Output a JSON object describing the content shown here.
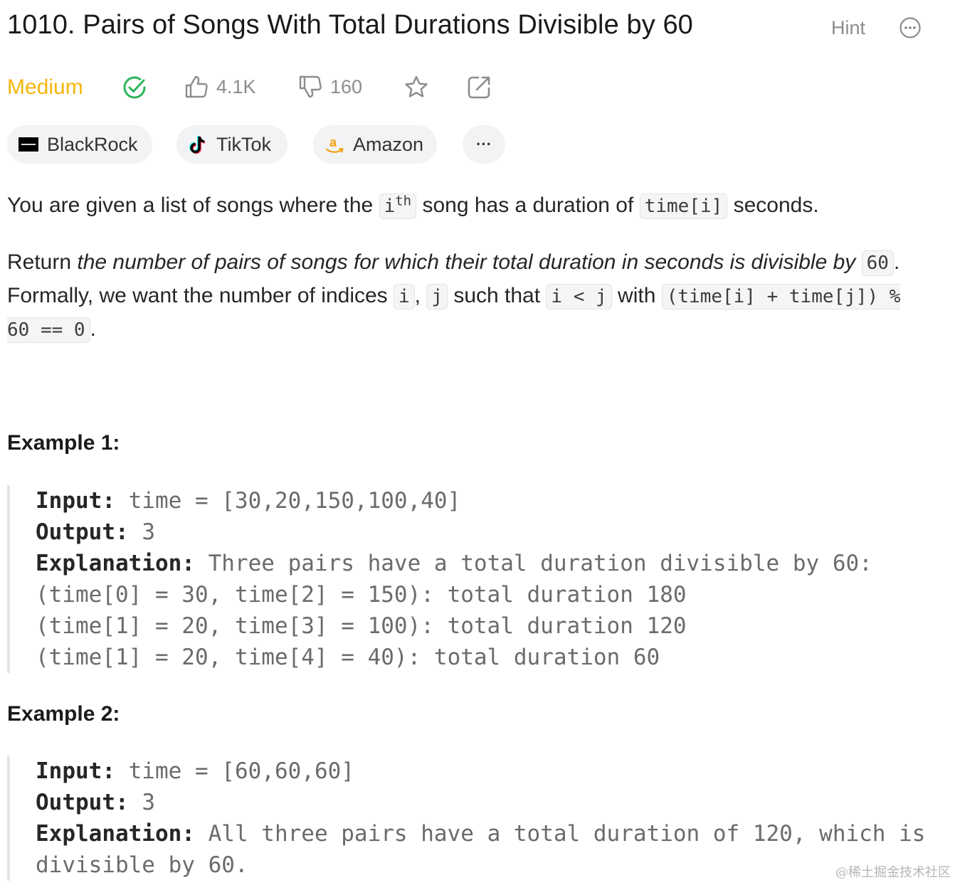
{
  "problem": {
    "title": "1010. Pairs of Songs With Total Durations Divisible by 60",
    "hint_label": "Hint",
    "difficulty": "Medium",
    "likes": "4.1K",
    "dislikes": "160"
  },
  "companies": [
    {
      "name": "BlackRock",
      "logo": "blackrock-logo"
    },
    {
      "name": "TikTok",
      "logo": "tiktok-logo"
    },
    {
      "name": "Amazon",
      "logo": "amazon-logo"
    }
  ],
  "more_label": "···",
  "description": {
    "p1_a": "You are given a list of songs where the ",
    "p1_code1": "i",
    "p1_sup": "th",
    "p1_b": " song has a duration of ",
    "p1_code2": "time[i]",
    "p1_c": " seconds.",
    "p2_a": "Return ",
    "p2_em": "the number of pairs of songs for which their total duration in seconds is divisible by",
    "p2_code1": "60",
    "p2_b": ". Formally, we want the number of indices ",
    "p2_code2": "i",
    "p2_c": ", ",
    "p2_code3": "j",
    "p2_d": " such that ",
    "p2_code4": "i < j",
    "p2_e": " with ",
    "p2_code5": "(time[i] + time[j]) % 60 == 0",
    "p2_f": "."
  },
  "examples": [
    {
      "heading": "Example 1:",
      "input_label": "Input:",
      "input": " time = [30,20,150,100,40]",
      "output_label": "Output:",
      "output": " 3",
      "explanation_label": "Explanation:",
      "explanation": " Three pairs have a total duration divisible by 60:",
      "extra": [
        "(time[0] = 30, time[2] = 150): total duration 180",
        "(time[1] = 20, time[3] = 100): total duration 120",
        "(time[1] = 20, time[4] = 40): total duration 60"
      ]
    },
    {
      "heading": "Example 2:",
      "input_label": "Input:",
      "input": " time = [60,60,60]",
      "output_label": "Output:",
      "output": " 3",
      "explanation_label": "Explanation:",
      "explanation": " All three pairs have a total duration of 120, which is",
      "extra": [
        "divisible by 60."
      ]
    }
  ],
  "watermark": "@稀土掘金技术社区",
  "colors": {
    "difficulty": "#f5b50a",
    "solved": "#2db55d",
    "muted": "#8c8c8c"
  }
}
